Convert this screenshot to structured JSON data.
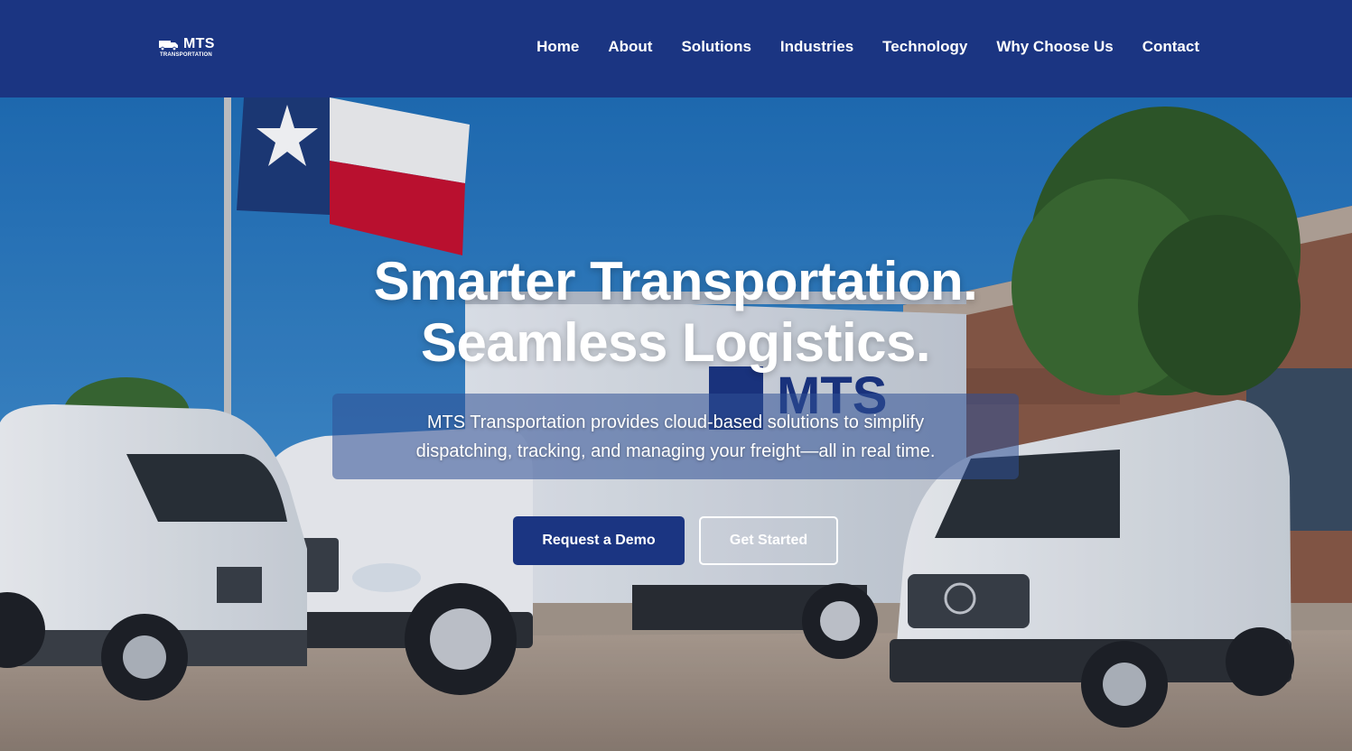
{
  "brand": {
    "logo_text": "MTS",
    "logo_subtext": "TRANSPORTATION",
    "primary_color": "#1b3582"
  },
  "nav": {
    "items": [
      {
        "label": "Home"
      },
      {
        "label": "About"
      },
      {
        "label": "Solutions"
      },
      {
        "label": "Industries"
      },
      {
        "label": "Technology"
      },
      {
        "label": "Why Choose Us"
      },
      {
        "label": "Contact"
      }
    ]
  },
  "hero": {
    "headline_line1": "Smarter Transportation.",
    "headline_line2": "Seamless Logistics.",
    "subtext": "MTS Transportation provides cloud-based solutions to simplify dispatching, tracking, and managing your freight—all in real time.",
    "truck_branding": "MTS",
    "primary_cta": "Request a Demo",
    "secondary_cta": "Get Started"
  }
}
